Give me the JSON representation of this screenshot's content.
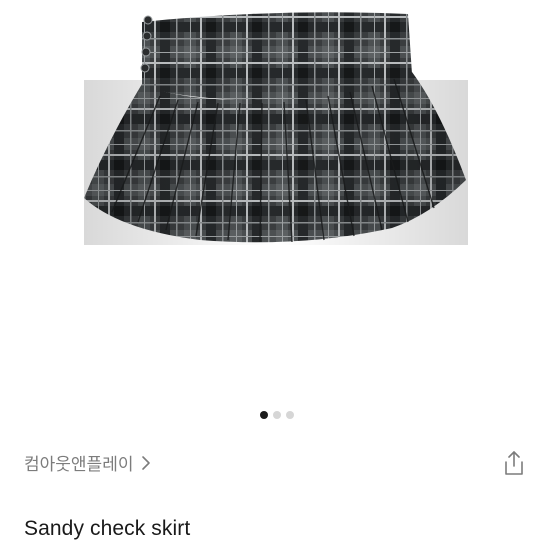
{
  "gallery": {
    "image_alt": "plaid pleated mini skirt",
    "page_count": 3,
    "active_page": 1
  },
  "product": {
    "brand": "컴아웃앤플레이",
    "title": "Sandy check skirt"
  },
  "icons": {
    "brand_chevron": "chevron-right-icon",
    "share": "share-icon"
  },
  "colors": {
    "active_dot": "#1c1c1c",
    "inactive_dot": "#d6d6d6",
    "brand_text": "#7c7c7c",
    "title_text": "#1a1a1a"
  }
}
